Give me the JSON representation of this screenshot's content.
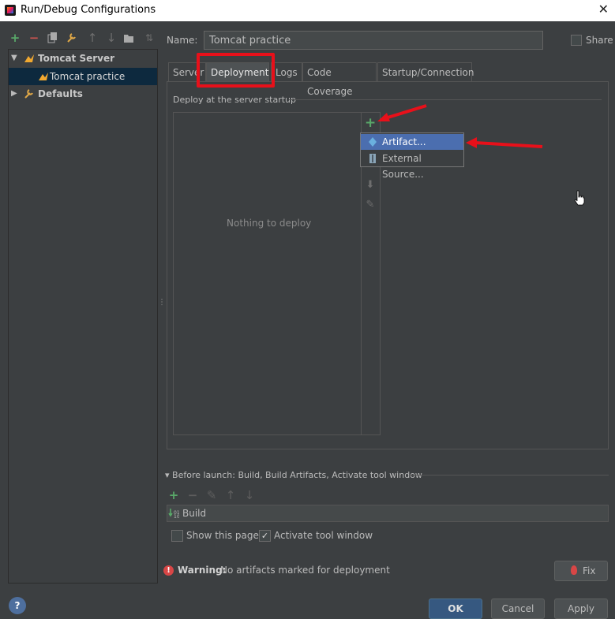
{
  "window": {
    "title": "Run/Debug Configurations",
    "close": "✕"
  },
  "tree": {
    "items": [
      {
        "label": "Tomcat Server"
      },
      {
        "label": "Tomcat practice"
      },
      {
        "label": "Defaults"
      }
    ]
  },
  "name": {
    "label": "Name:",
    "value": "Tomcat practice"
  },
  "share": {
    "label": "Share"
  },
  "tabs": [
    {
      "label": "Server"
    },
    {
      "label": "Deployment"
    },
    {
      "label": "Logs"
    },
    {
      "label": "Code Coverage"
    },
    {
      "label": "Startup/Connection"
    }
  ],
  "deployment": {
    "caption": "Deploy at the server startup",
    "empty_text": "Nothing to deploy",
    "popup": [
      {
        "label": "Artifact..."
      },
      {
        "label": "External Source..."
      }
    ]
  },
  "before_launch": {
    "caption": "Before launch: Build, Build Artifacts, Activate tool window",
    "items": [
      {
        "label": "Build"
      }
    ],
    "show_this_page": "Show this page",
    "activate_tool_window": "Activate tool window"
  },
  "warning": {
    "label": "Warning:",
    "text": "No artifacts marked for deployment"
  },
  "buttons": {
    "fix": "Fix",
    "ok": "OK",
    "cancel": "Cancel",
    "apply": "Apply",
    "help": "?"
  },
  "colors": {
    "accent": "#4b6eaf",
    "annotation": "#e8101a",
    "add": "#59a869"
  }
}
